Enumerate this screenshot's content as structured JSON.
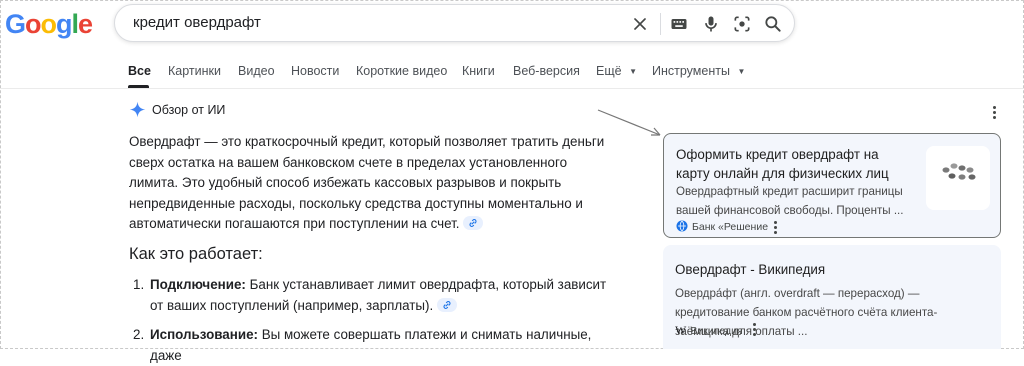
{
  "search": {
    "query": "кредит овердрафт",
    "icons": [
      "close-icon",
      "keyboard-icon",
      "microphone-icon",
      "lens-icon",
      "search-icon"
    ]
  },
  "logo": {
    "text": "Google",
    "colors": [
      "#4285F4",
      "#EA4335",
      "#FBBC05",
      "#4285F4",
      "#34A853",
      "#EA4335"
    ]
  },
  "tabs": [
    {
      "label": "Все",
      "active": true
    },
    {
      "label": "Картинки"
    },
    {
      "label": "Видео"
    },
    {
      "label": "Новости"
    },
    {
      "label": "Короткие видео"
    },
    {
      "label": "Книги"
    },
    {
      "label": "Веб-версия"
    },
    {
      "label": "Ещё"
    },
    {
      "label": "Инструменты"
    }
  ],
  "ai_overview": {
    "title": "Обзор от ИИ",
    "paragraph": "Овердрафт — это краткосрочный кредит, который позволяет тратить деньги сверх остатка на вашем банковском счете в пределах установленного лимита. Это удобный способ избежать кассовых разрывов и покрыть непредвиденные расходы, поскольку средства доступны моментально и автоматически погашаются при поступлении на счет.",
    "how_heading": "Как это работает:",
    "items": [
      {
        "num": "1.",
        "bold": "Подключение:",
        "text": " Банк устанавливает лимит овердрафта, который зависит от ваших поступлений (например, зарплаты)."
      },
      {
        "num": "2.",
        "bold": "Использование:",
        "text": " Вы можете совершать платежи и снимать наличные, даже"
      }
    ]
  },
  "sources": [
    {
      "title": "Оформить кредит овердрафт на карту онлайн для физических лиц",
      "snippet": "Овердрафтный кредит расширит границы вашей финансовой свободы. Проценты ...",
      "source": "Банк «Решение"
    },
    {
      "title": "Овердрафт - Википедия",
      "snippet": "Овердра́фт (англ. overdraft — перерасход) — кредитование банком расчётного счёта клиента-заёмщика для оплаты ...",
      "source": "Википедия"
    }
  ],
  "colors": {
    "accent_blue": "#1a73e8",
    "card_bg": "#f3f6fc",
    "chip_bg": "#e8f0fe"
  }
}
